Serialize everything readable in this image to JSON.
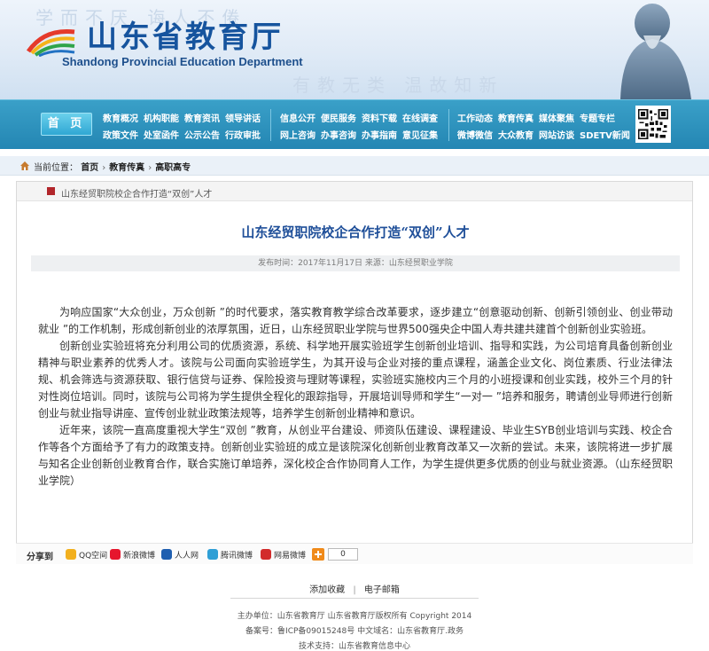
{
  "colors": {
    "nav_bg": "#2486b3",
    "title_blue": "#1f4f99",
    "brand_blue": "#16549e",
    "accent_red": "#b2262b"
  },
  "header": {
    "title_cn": "山东省教育厅",
    "title_en": "Shandong Provincial Education Department"
  },
  "nav": {
    "home": "首 页",
    "group1_row1": [
      "教育概况",
      "机构职能",
      "教育资讯",
      "领导讲话"
    ],
    "group1_row2": [
      "政策文件",
      "处室函件",
      "公示公告",
      "行政审批"
    ],
    "group2_row1": [
      "信息公开",
      "便民服务",
      "资料下载",
      "在线调查"
    ],
    "group2_row2": [
      "网上咨询",
      "办事咨询",
      "办事指南",
      "意见征集"
    ],
    "group3_row1": [
      "工作动态",
      "教育传真",
      "媒体聚焦",
      "专题专栏"
    ],
    "group3_row2": [
      "微博微信",
      "大众教育",
      "网站访谈",
      "SDETV新闻"
    ],
    "qr_icon": "qr-code-icon"
  },
  "breadcrumb": {
    "label": "当前位置：",
    "items": [
      "首页",
      "教育传真",
      "高职高专"
    ]
  },
  "panel_header": "山东经贸职院校企合作打造“双创”人才",
  "article": {
    "title": "山东经贸职院校企合作打造“双创”人才",
    "meta": "发布时间：2017年11月17日   来源：山东经贸职业学院",
    "paragraphs": [
      "为响应国家“大众创业，万众创新 ”的时代要求，落实教育教学综合改革要求，逐步建立“创意驱动创新、创新引领创业、创业带动就业 ”的工作机制，形成创新创业的浓厚氛围，近日，山东经贸职业学院与世界500强央企中国人寿共建共建首个创新创业实验班。",
      "创新创业实验班将充分利用公司的优质资源，系统、科学地开展实验班学生创新创业培训、指导和实践，为公司培育具备创新创业精神与职业素养的优秀人才。该院与公司面向实验班学生，为其开设与企业对接的重点课程，涵盖企业文化、岗位素质、行业法律法规、机会筛选与资源获取、银行信贷与证券、保险投资与理财等课程，实验班实施校内三个月的小班授课和创业实践，校外三个月的针对性岗位培训。同时，该院与公司将为学生提供全程化的跟踪指导，开展培训导师和学生“一对一 ”培养和服务，聘请创业导师进行创新创业与就业指导讲座、宣传创业就业政策法规等，培养学生创新创业精神和意识。",
      "近年来，该院一直高度重视大学生“双创 ”教育，从创业平台建设、师资队伍建设、课程建设、毕业生SYB创业培训与实践、校企合作等各个方面给予了有力的政策支持。创新创业实验班的成立是该院深化创新创业教育改革又一次新的尝试。未来，该院将进一步扩展与知名企业创新创业教育合作，联合实施订单培养，深化校企合作协同育人工作，为学生提供更多优质的创业与就业资源。（山东经贸职业学院）"
    ]
  },
  "share": {
    "label": "分享到",
    "items": [
      {
        "label": "QQ空间",
        "color": "#f2b01e",
        "icon": "qzone-icon"
      },
      {
        "label": "新浪微博",
        "color": "#e6162d",
        "icon": "weibo-icon"
      },
      {
        "label": "人人网",
        "color": "#1f5fb0",
        "icon": "renren-icon"
      },
      {
        "label": "腾讯微博",
        "color": "#2f9fd6",
        "icon": "tencent-weibo-icon"
      },
      {
        "label": "网易微博",
        "color": "#d22b2b",
        "icon": "netease-weibo-icon"
      }
    ],
    "more_icon": "plus-icon",
    "count": "0"
  },
  "footer": {
    "link1": "添加收藏",
    "link2": "电子邮箱",
    "line1": "主办单位：山东省教育厅  山东省教育厅版权所有 Copyright 2014",
    "line2": "备案号：鲁ICP备09015248号  中文域名：山东省教育厅.政务",
    "line3": "技术支持：山东省教育信息中心"
  }
}
